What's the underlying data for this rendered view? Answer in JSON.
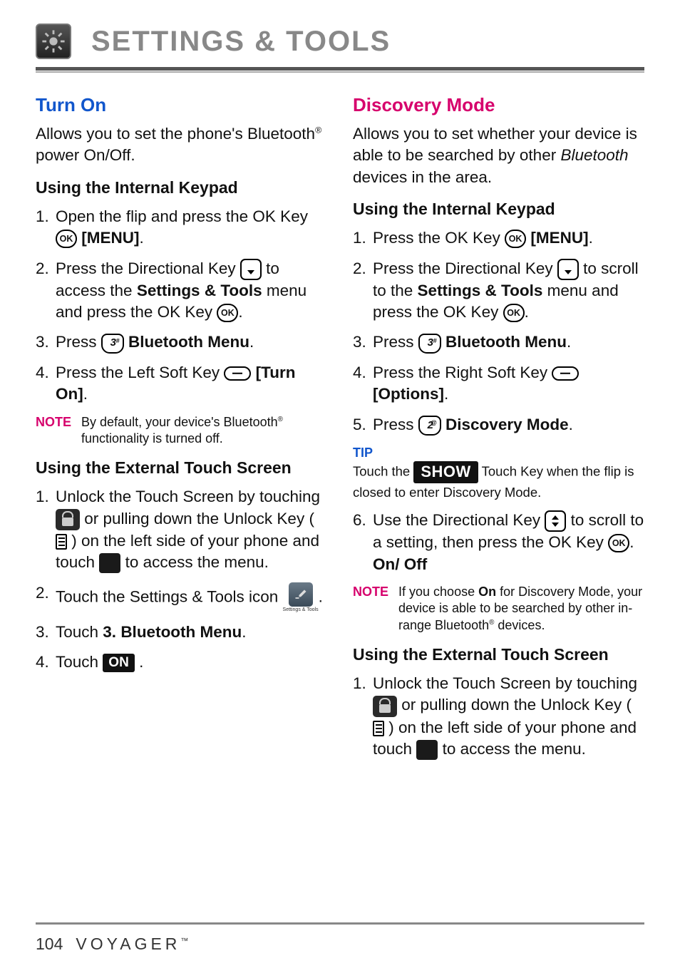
{
  "header": {
    "title": "SETTINGS & TOOLS"
  },
  "left": {
    "section_title": "Turn On",
    "intro_a": "Allows you to set the phone's Bluetooth",
    "intro_b": " power On/Off.",
    "sub1": "Using the Internal Keypad",
    "s1_a": "Open the flip and press the OK Key ",
    "s1_b": "[MENU]",
    "s2_a": "Press the Directional Key ",
    "s2_b": " to access the ",
    "s2_c": "Settings & Tools",
    "s2_d": " menu and press the OK Key ",
    "s3_a": "Press ",
    "s3_b": "Bluetooth Menu",
    "s4_a": "Press the Left Soft Key ",
    "s4_b": "[Turn On]",
    "note_label": "NOTE",
    "note_a": "By default, your device's Bluetooth",
    "note_b": " functionality is turned off.",
    "sub2": "Using the External Touch Screen",
    "e1_a": "Unlock the Touch Screen by touching ",
    "e1_b": " or pulling down the Unlock Key ( ",
    "e1_c": " ) on the left side of your phone and touch ",
    "e1_d": " to access the menu.",
    "e2_a": "Touch the Settings & Tools icon ",
    "e2_b": "Settings & Tools",
    "e3_a": "Touch ",
    "e3_b": "3. Bluetooth Menu",
    "e4_a": "Touch ",
    "e4_pill": "ON"
  },
  "right": {
    "section_title": "Discovery Mode",
    "intro_a": "Allows you to set whether your device is able to be searched by other ",
    "intro_em": "Bluetooth",
    "intro_b": " devices in the area.",
    "sub1": "Using the Internal Keypad",
    "s1_a": "Press the OK Key ",
    "s1_b": "[MENU]",
    "s2_a": "Press the Directional Key ",
    "s2_b": " to scroll to the ",
    "s2_c": "Settings & Tools",
    "s2_d": " menu and press the OK Key ",
    "s3_a": "Press ",
    "s3_b": "Bluetooth Menu",
    "s4_a": "Press the Right Soft Key ",
    "s4_b": "[Options]",
    "s5_a": "Press ",
    "s5_b": "Discovery Mode",
    "tip_label": "TIP",
    "tip_a": "Touch the ",
    "tip_pill": "SHOW",
    "tip_b": " Touch Key when the flip is closed to enter Discovery Mode.",
    "s6_a": "Use the Directional Key ",
    "s6_b": " to scroll to a setting, then press the OK Key ",
    "s6_c": "On/ Off",
    "note_label": "NOTE",
    "note_a": "If you choose ",
    "note_bold": "On",
    "note_b": " for Discovery Mode, your device is able to be searched by other in-range Bluetooth",
    "note_c": " devices.",
    "sub2": "Using the External Touch Screen",
    "e1_a": "Unlock the Touch Screen by touching ",
    "e1_b": " or pulling down the Unlock Key ( ",
    "e1_c": " ) on the left side of your phone and touch ",
    "e1_d": " to access the menu."
  },
  "footer": {
    "page": "104",
    "brand": "VOYAGER"
  },
  "keys": {
    "ok": "OK",
    "k3_num": "3",
    "k3_sup": "#",
    "k2_num": "2",
    "k2_sup": "@"
  }
}
